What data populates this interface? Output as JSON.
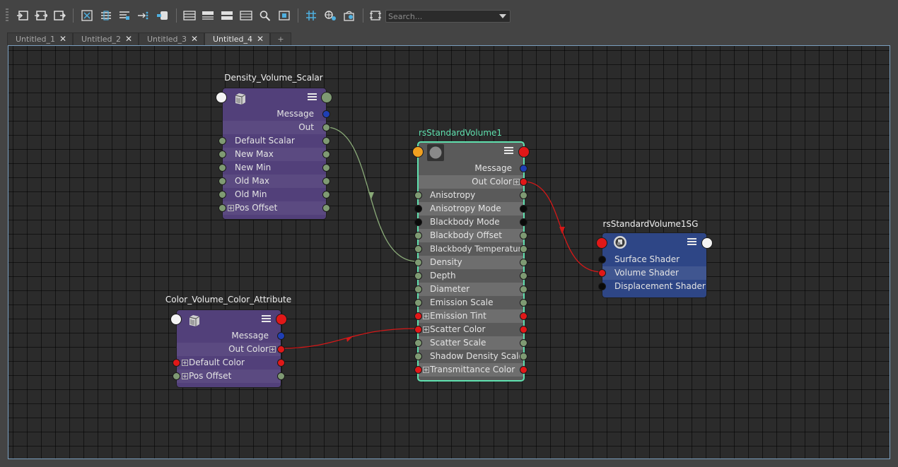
{
  "toolbar": {
    "icons": [
      "graph-input-icon",
      "graph-input-output-icon",
      "graph-output-icon",
      "frame-all-icon",
      "frame-selected-icon",
      "layout-icon",
      "pin-icon",
      "bookmark-icon",
      "swatch-compact-icon",
      "swatch-simple-icon",
      "swatch-full-icon",
      "swatch-custom-icon",
      "search-icon",
      "material-viewer-icon",
      "grid-icon",
      "snap-icon",
      "refresh-icon",
      "export-icon"
    ],
    "search_placeholder": "Search..."
  },
  "tabs": [
    {
      "label": "Untitled_1",
      "active": false
    },
    {
      "label": "Untitled_2",
      "active": false
    },
    {
      "label": "Untitled_3",
      "active": false
    },
    {
      "label": "Untitled_4",
      "active": true
    }
  ],
  "add_tab_label": "+",
  "close_glyph": "✕",
  "colors": {
    "grid_bg": "#2b2b2b",
    "utility_node": "#52407a",
    "shader_node": "#5a5a5a",
    "shading_group_node": "#2e4686",
    "selected_outline": "#5fe0ae",
    "scalar_wire": "#8aaa78",
    "color_wire": "#d41818"
  },
  "nodes": {
    "density": {
      "title": "Density_Volume_Scalar",
      "outputs": [
        "Message",
        "Out"
      ],
      "attributes": [
        "Default Scalar",
        "New Max",
        "New Min",
        "Old Max",
        "Old Min",
        "Pos Offset"
      ]
    },
    "color": {
      "title": "Color_Volume_Color_Attribute",
      "outputs": [
        "Message",
        "Out Color"
      ],
      "attributes": [
        "Default Color",
        "Pos Offset"
      ]
    },
    "volume": {
      "title": "rsStandardVolume1",
      "outputs": [
        "Message",
        "Out Color"
      ],
      "attributes": [
        "Anisotropy",
        "Anisotropy Mode",
        "Blackbody Mode",
        "Blackbody Offset",
        "Blackbody Temperature",
        "Density",
        "Depth",
        "Diameter",
        "Emission Scale",
        "Emission Tint",
        "Scatter Color",
        "Scatter Scale",
        "Shadow Density Scale",
        "Transmittance Color"
      ]
    },
    "sg": {
      "title": "rsStandardVolume1SG",
      "attributes": [
        "Surface Shader",
        "Volume Shader",
        "Displacement Shader"
      ]
    }
  },
  "connections": [
    {
      "from": "Density_Volume_Scalar.Out",
      "to": "rsStandardVolume1.Density"
    },
    {
      "from": "Color_Volume_Color_Attribute.Out Color",
      "to": "rsStandardVolume1.Scatter Color"
    },
    {
      "from": "rsStandardVolume1.Out Color",
      "to": "rsStandardVolume1SG.Volume Shader"
    }
  ]
}
